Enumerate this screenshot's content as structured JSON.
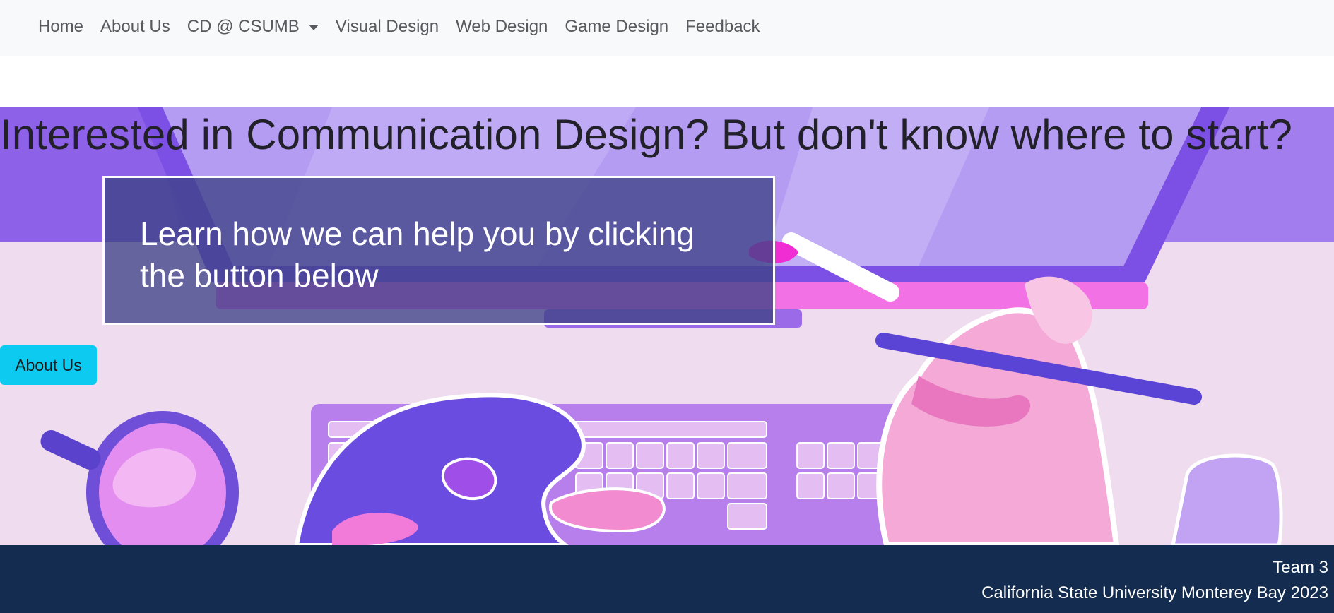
{
  "nav": {
    "items": [
      {
        "label": "Home"
      },
      {
        "label": "About Us"
      },
      {
        "label": "CD @ CSUMB"
      },
      {
        "label": "Visual Design"
      },
      {
        "label": "Web Design"
      },
      {
        "label": "Game Design"
      },
      {
        "label": "Feedback"
      }
    ]
  },
  "hero": {
    "title": "Interested in Communication Design? But don't know where to start?",
    "box_text": "Learn how we can help you by clicking the button below",
    "button_label": "About Us",
    "illustration_icon": "desk-illustration"
  },
  "footer": {
    "team": "Team 3",
    "university": "California State University Monterey Bay 2023"
  },
  "colors": {
    "navbar_bg": "#f8f9fa",
    "button": "#0dcaf0",
    "footer_bg": "#132c4f",
    "hero_purple": "#8e62e8"
  }
}
